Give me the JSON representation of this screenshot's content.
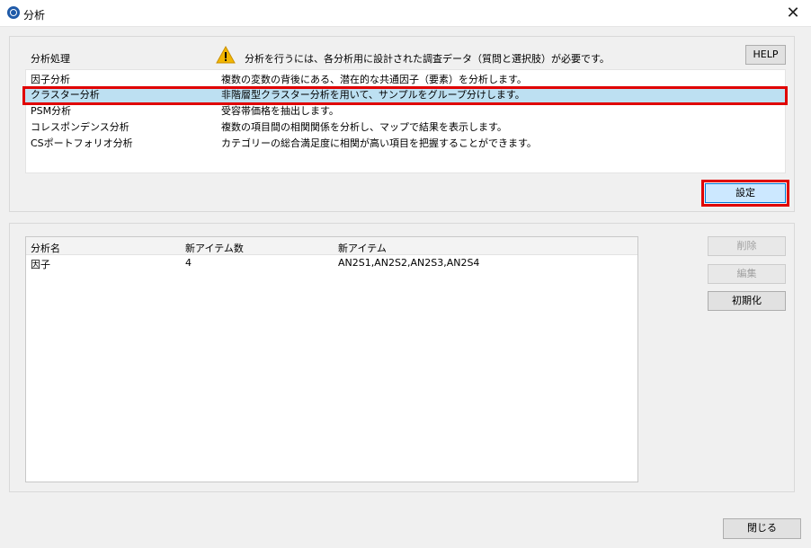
{
  "window": {
    "title": "分析",
    "close_label": "✕"
  },
  "analysis": {
    "header_label": "分析処理",
    "notice": "分析を行うには、各分析用に設計された調査データ（質問と選択肢）が必要です。",
    "help_label": "HELP",
    "items": [
      {
        "name": "因子分析",
        "desc": "複数の変数の背後にある、潜在的な共通因子（要素）を分析します。"
      },
      {
        "name": "クラスター分析",
        "desc": "非階層型クラスター分析を用いて、サンプルをグループ分けします。"
      },
      {
        "name": "PSM分析",
        "desc": "受容帯価格を抽出します。"
      },
      {
        "name": "コレスポンデンス分析",
        "desc": "複数の項目間の相関関係を分析し、マップで結果を表示します。"
      },
      {
        "name": "CSポートフォリオ分析",
        "desc": "カテゴリーの総合満足度に相関が高い項目を把握することができます。"
      }
    ],
    "selected_index": 1,
    "settings_label": "設定"
  },
  "results": {
    "columns": [
      "分析名",
      "新アイテム数",
      "新アイテム"
    ],
    "rows": [
      [
        "因子",
        "4",
        "AN2S1,AN2S2,AN2S3,AN2S4"
      ]
    ],
    "delete_label": "削除",
    "edit_label": "編集",
    "reset_label": "初期化"
  },
  "footer": {
    "close_label": "閉じる"
  },
  "colors": {
    "selection": "#bde0f2",
    "highlight_box": "#e00000",
    "settings_button": "#cce8ff",
    "warning": "#f2b600"
  }
}
